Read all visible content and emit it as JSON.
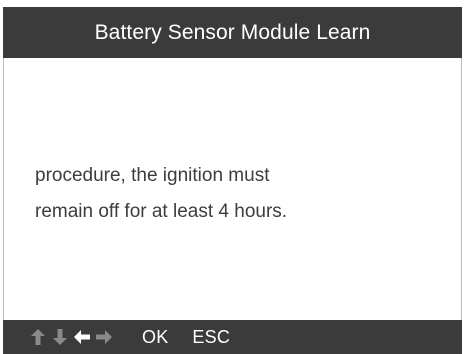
{
  "title_bar": {
    "title": "Battery Sensor Module Learn"
  },
  "message": {
    "lines": [
      "procedure, the ignition must",
      "remain off for at least 4 hours."
    ]
  },
  "bottom_bar": {
    "buttons": [
      {
        "icon": "arrow-up-icon",
        "enabled": false
      },
      {
        "icon": "arrow-down-icon",
        "enabled": false
      },
      {
        "icon": "arrow-left-icon",
        "enabled": true
      },
      {
        "icon": "arrow-right-icon",
        "enabled": false
      }
    ],
    "ok_label": "OK",
    "esc_label": "ESC"
  },
  "colors": {
    "bar_background": "#3b3b3b",
    "text": "#3d3d3d",
    "icon_enabled": "#ffffff",
    "icon_disabled": "#8a8a8a"
  }
}
